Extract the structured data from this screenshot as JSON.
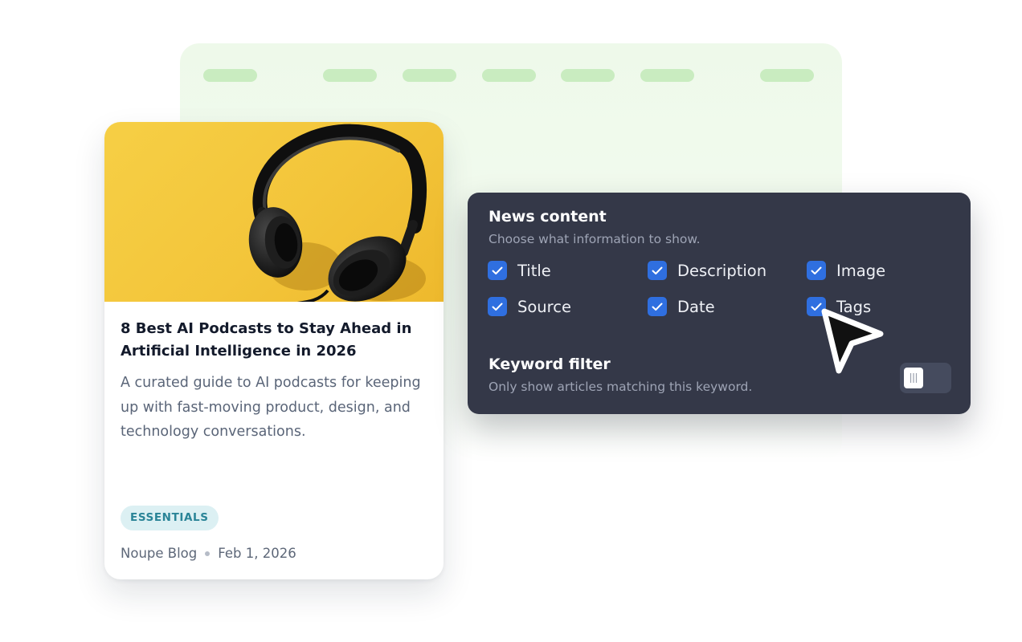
{
  "article": {
    "title": "8 Best AI Podcasts to Stay Ahead in Artificial Intelligence in 2026",
    "description": "A curated guide to AI podcasts for keeping up with fast-moving product, design, and technology conversations.",
    "tag": "ESSENTIALS",
    "source": "Noupe Blog",
    "date": "Feb 1, 2026",
    "image_icon": "headphones-image"
  },
  "panel": {
    "title": "News content",
    "subtitle": "Choose what information to show.",
    "options": [
      {
        "label": "Title",
        "checked": true
      },
      {
        "label": "Description",
        "checked": true
      },
      {
        "label": "Image",
        "checked": true
      },
      {
        "label": "Source",
        "checked": true
      },
      {
        "label": "Date",
        "checked": true
      },
      {
        "label": "Tags",
        "checked": true
      }
    ],
    "keyword": {
      "title": "Keyword filter",
      "subtitle": "Only show articles matching this keyword.",
      "enabled": false
    }
  },
  "colors": {
    "accent": "#2f6fe0",
    "panel_bg": "#343848",
    "background_window": "#eef9ea",
    "tag_bg": "#dcf0f3",
    "tag_text": "#2a8497"
  }
}
